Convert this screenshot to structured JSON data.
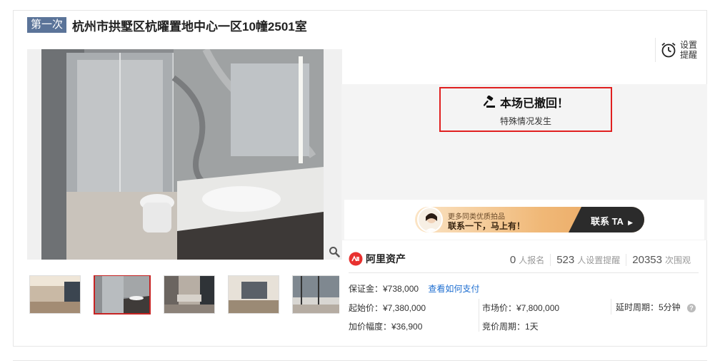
{
  "header": {
    "round_badge": "第一次",
    "title": "杭州市拱墅区杭曜置地中心一区10幢2501室"
  },
  "remind": {
    "line1": "设置",
    "line2": "提醒"
  },
  "status": {
    "title": "本场已撤回！",
    "subtitle": "特殊情况发生"
  },
  "ad": {
    "line1": "更多同类优质拍品",
    "line2": "联系一下，马上有！",
    "cta": "联系 TA"
  },
  "brand": {
    "name": "阿里资产"
  },
  "stats": [
    {
      "num": "0",
      "label": "人报名"
    },
    {
      "num": "523",
      "label": "人设置提醒"
    },
    {
      "num": "20353",
      "label": "次围观"
    }
  ],
  "details": {
    "deposit": "保证金：¥738,000",
    "deposit_link": "查看如何支付",
    "start_price": "起始价：¥7,380,000",
    "market_price": "市场价：¥7,800,000",
    "delay_period": "延时周期：5分钟",
    "increment": "加价幅度：¥36,900",
    "bid_period": "竞价周期：1天"
  },
  "gallery": {
    "thumb_count": 5,
    "active_index": 1
  },
  "colors": {
    "badge_bg": "#5b7499",
    "highlight_border": "#e02020",
    "link": "#1f6fd1",
    "brand_red": "#e8312f"
  }
}
